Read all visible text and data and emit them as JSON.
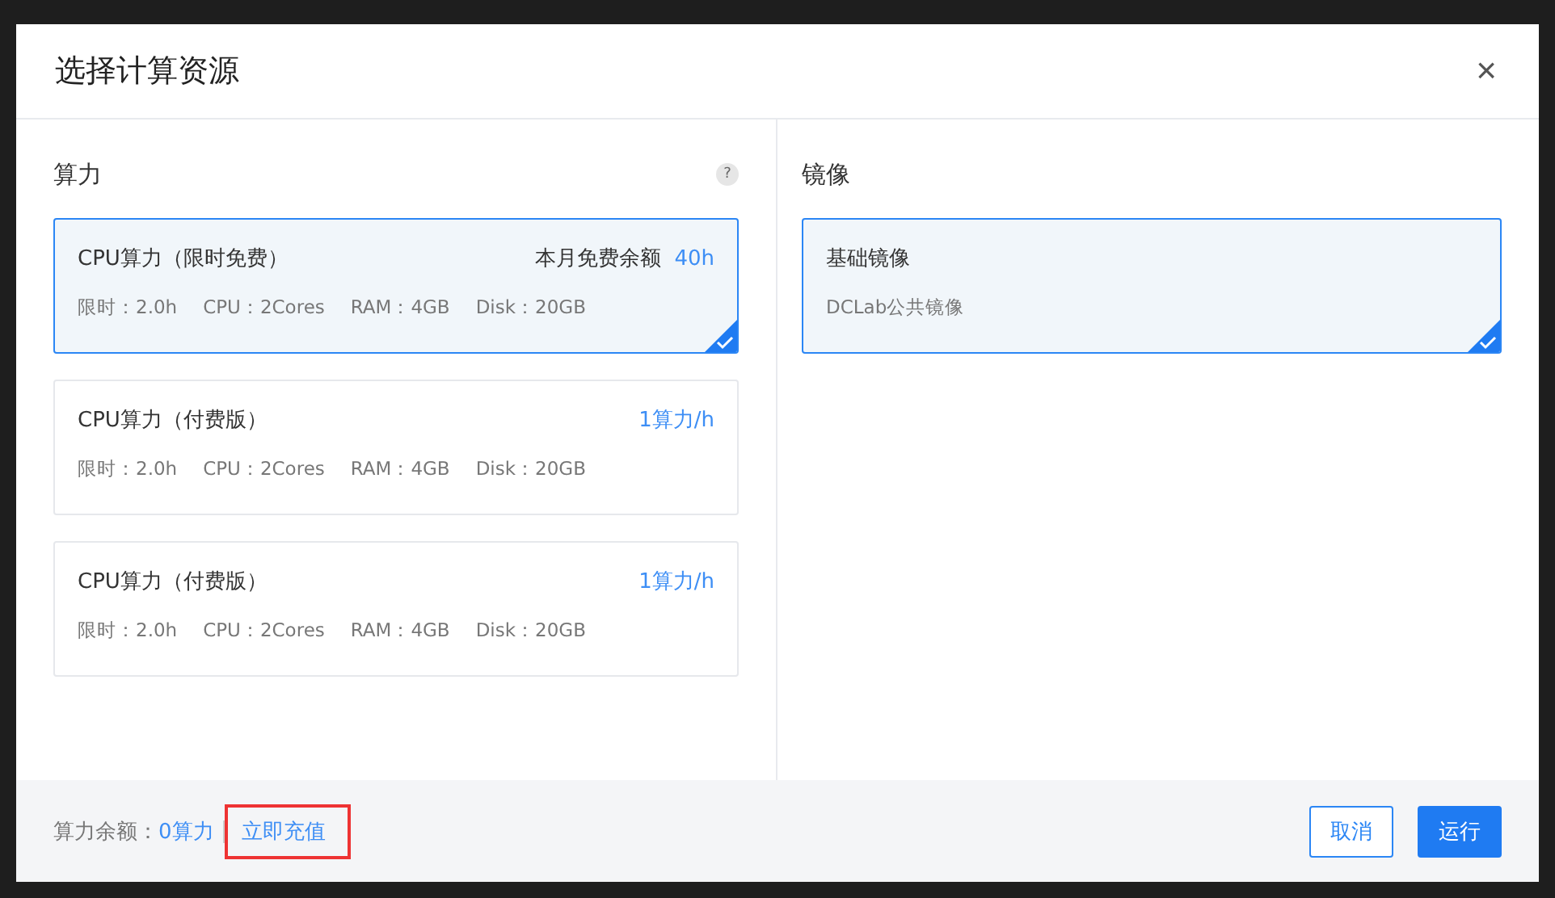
{
  "dialog": {
    "title": "选择计算资源",
    "close": "×"
  },
  "compute": {
    "heading": "算力",
    "help": "?",
    "options": [
      {
        "name": "CPU算力（限时免费）",
        "price_label": "本月免费余额",
        "price": "40h",
        "specs": [
          "限时：2.0h",
          "CPU：2Cores",
          "RAM：4GB",
          "Disk：20GB"
        ],
        "selected": true
      },
      {
        "name": "CPU算力（付费版）",
        "price": "1算力/h",
        "specs": [
          "限时：2.0h",
          "CPU：2Cores",
          "RAM：4GB",
          "Disk：20GB"
        ],
        "selected": false
      },
      {
        "name": "CPU算力（付费版）",
        "price": "1算力/h",
        "specs": [
          "限时：2.0h",
          "CPU：2Cores",
          "RAM：4GB",
          "Disk：20GB"
        ],
        "selected": false
      }
    ]
  },
  "image": {
    "heading": "镜像",
    "options": [
      {
        "name": "基础镜像",
        "desc": "DCLab公共镜像",
        "selected": true
      }
    ]
  },
  "footer": {
    "balance_label": "算力余额：",
    "balance": "0算力",
    "recharge": {
      "label": "立即充值",
      "highlighted": true
    },
    "buttons": [
      {
        "label": "取消",
        "kind": "secondary"
      },
      {
        "label": "运行",
        "kind": "primary"
      }
    ]
  }
}
